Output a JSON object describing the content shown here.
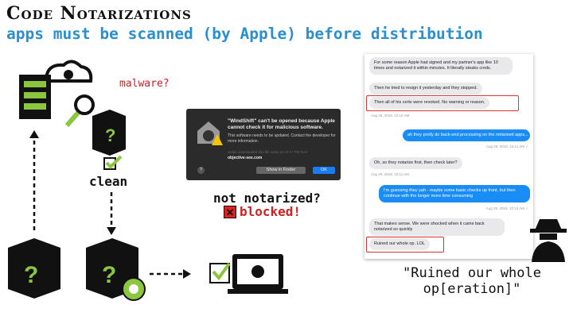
{
  "slide": {
    "title": "Code Notarizations",
    "subtitle": "apps must be scanned (by Apple) before distribution"
  },
  "flow": {
    "malware_label": "malware?",
    "clean_label": "clean",
    "not_notarized": "not notarized?",
    "blocked": "blocked!"
  },
  "dialog": {
    "title": "\"WindShift\" can't be opened because Apple cannot check it for malicious software.",
    "body": "This software needs to be updated. Contact the developer for more information.",
    "source_line": "Safari downloaded this file today at 10:17 PM from",
    "domain": "objective-see.com",
    "help": "?",
    "show_in_finder": "Show in Finder",
    "ok": "OK"
  },
  "chat": {
    "messages": [
      {
        "dir": "in",
        "text": "For some reason Apple had signed and  my partner's app like 10 times and notarized it within minutes.  It literally steaks creds."
      },
      {
        "dir": "in",
        "text": "Then he tried to resign it yesterday and they stopped."
      },
      {
        "dir": "in",
        "text": "Then all of his certs were revoked. No warning or reason.",
        "highlight": true
      },
      {
        "dir": "ts",
        "text": "Aug 29, 2019, 10:10 AM"
      },
      {
        "dir": "out",
        "text": "ah they prolly do back-end processing on the notarized apps..."
      },
      {
        "dir": "ts",
        "text": "Aug 29, 2019, 10:11 AM ✓"
      },
      {
        "dir": "in",
        "text": "Oh, so they notarize first, then check later?"
      },
      {
        "dir": "ts",
        "text": "Aug 29, 2019, 10:11 AM"
      },
      {
        "dir": "out",
        "text": "I'm guessing they yah - maybe some basic checks up front, but then continue with the longer more time consuming"
      },
      {
        "dir": "ts",
        "text": "Aug 29, 2019, 10:13 AM ✓"
      },
      {
        "dir": "in",
        "text": "That makes sense.  We were shocked when it came back notarized so quickly"
      },
      {
        "dir": "in",
        "text": "Ruined our whole op.  LOL",
        "highlight": true
      }
    ]
  },
  "quote": "\"Ruined our whole op[eration]\"",
  "colors": {
    "accent": "#2a8fd0",
    "green": "#8cc63f",
    "red": "#d33"
  }
}
